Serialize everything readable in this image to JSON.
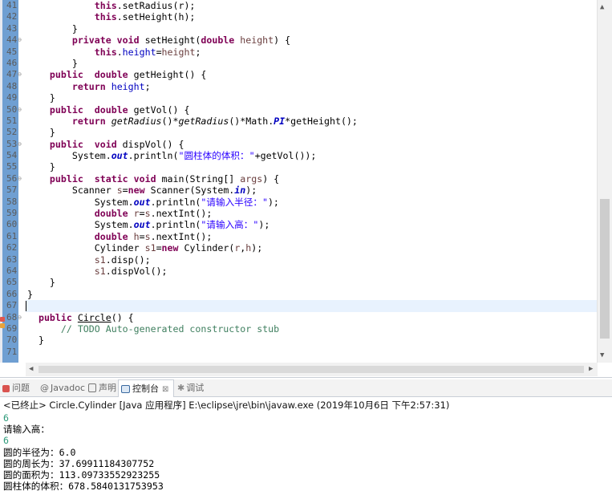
{
  "editor": {
    "lines": [
      {
        "n": "41",
        "fold": "",
        "html": "            <span class=\"kw\">this</span>.setRadius(r);"
      },
      {
        "n": "42",
        "fold": "",
        "html": "            <span class=\"kw\">this</span>.setHeight(h);"
      },
      {
        "n": "43",
        "fold": "",
        "html": "        }"
      },
      {
        "n": "44",
        "fold": "⊖",
        "html": "        <span class=\"kw\">private void</span> setHeight(<span class=\"kw\">double</span> <span class=\"loc\">height</span>) {"
      },
      {
        "n": "45",
        "fold": "",
        "html": "            <span class=\"kw\">this</span>.<span class=\"fld\">height</span>=<span class=\"loc\">height</span>;"
      },
      {
        "n": "46",
        "fold": "",
        "html": "        }"
      },
      {
        "n": "47",
        "fold": "⊖",
        "html": "    <span class=\"kw\">public</span>  <span class=\"kw\">double</span> getHeight() {"
      },
      {
        "n": "48",
        "fold": "",
        "html": "        <span class=\"kw\">return</span> <span class=\"fld\">height</span>;"
      },
      {
        "n": "49",
        "fold": "",
        "html": "    }"
      },
      {
        "n": "50",
        "fold": "⊖",
        "html": "    <span class=\"kw\">public</span>  <span class=\"kw\">double</span> getVol() {"
      },
      {
        "n": "51",
        "fold": "",
        "html": "        <span class=\"kw\">return</span> <span class=\"it\">getRadius</span>()*<span class=\"it\">getRadius</span>()*Math.<span class=\"sf\">PI</span>*getHeight();"
      },
      {
        "n": "52",
        "fold": "",
        "html": "    }"
      },
      {
        "n": "53",
        "fold": "⊖",
        "html": "    <span class=\"kw\">public</span>  <span class=\"kw\">void</span> dispVol() {"
      },
      {
        "n": "54",
        "fold": "",
        "html": "        System.<span class=\"sf\">out</span>.println(<span class=\"str\">\"圆柱体的体积：\"</span>+getVol());"
      },
      {
        "n": "55",
        "fold": "",
        "html": "    }"
      },
      {
        "n": "56",
        "fold": "⊖",
        "html": "    <span class=\"kw\">public</span>  <span class=\"kw\">static void</span> main(String[] <span class=\"loc\">args</span>) {"
      },
      {
        "n": "57",
        "fold": "",
        "html": "        Scanner <span class=\"loc\">s</span>=<span class=\"kw\">new</span> Scanner(System.<span class=\"sf\">in</span>);"
      },
      {
        "n": "58",
        "fold": "",
        "html": "            System.<span class=\"sf\">out</span>.println(<span class=\"str\">\"请输入半径：\"</span>);"
      },
      {
        "n": "59",
        "fold": "",
        "html": "            <span class=\"kw\">double</span> <span class=\"loc\">r</span>=<span class=\"loc\">s</span>.nextInt();"
      },
      {
        "n": "60",
        "fold": "",
        "html": "            System.<span class=\"sf\">out</span>.println(<span class=\"str\">\"请输入高：\"</span>);"
      },
      {
        "n": "61",
        "fold": "",
        "html": "            <span class=\"kw\">double</span> <span class=\"loc\">h</span>=<span class=\"loc\">s</span>.nextInt();"
      },
      {
        "n": "62",
        "fold": "",
        "html": "            Cylinder <span class=\"loc\">s1</span>=<span class=\"kw\">new</span> Cylinder(<span class=\"loc\">r</span>,<span class=\"loc\">h</span>);"
      },
      {
        "n": "63",
        "fold": "",
        "html": "            <span class=\"loc\">s1</span>.disp();"
      },
      {
        "n": "64",
        "fold": "",
        "html": "            <span class=\"loc\">s1</span>.dispVol();"
      },
      {
        "n": "65",
        "fold": "",
        "html": "    }"
      },
      {
        "n": "66",
        "fold": "",
        "html": "}"
      },
      {
        "n": "67",
        "fold": "",
        "html": "<span class=\"caret\"></span>",
        "current": true
      },
      {
        "n": "68",
        "fold": "⊖",
        "html": "  <span class=\"kw\">public</span> <span class=\"ul\">Circle</span>() {"
      },
      {
        "n": "69",
        "fold": "",
        "html": "      <span class=\"cmt\">// TODO Auto-generated constructor stub</span>"
      },
      {
        "n": "70",
        "fold": "",
        "html": "  }"
      },
      {
        "n": "71",
        "fold": "",
        "html": ""
      }
    ],
    "colors": {
      "gutter": "#6f9fd2",
      "keyword": "#7f0055",
      "string": "#2a00ff",
      "comment": "#3f7f5f",
      "field": "#0000c0"
    }
  },
  "tabs": [
    {
      "label": "问题",
      "icon": "problems-icon"
    },
    {
      "label": "Javadoc",
      "icon": "javadoc-icon"
    },
    {
      "label": "声明",
      "icon": "declaration-icon"
    },
    {
      "label": "控制台",
      "icon": "console-icon",
      "close": "⊠"
    },
    {
      "label": "调试",
      "icon": "debug-icon"
    }
  ],
  "console": {
    "status": "<已终止> Circle.Cylinder [Java 应用程序] E:\\eclipse\\jre\\bin\\javaw.exe  (2019年10月6日 下午2:57:31)",
    "lines": [
      {
        "text": "6",
        "input": true
      },
      {
        "text": "请输入高：",
        "input": false
      },
      {
        "text": "6",
        "input": true
      },
      {
        "text": "圆的半径为：6.0",
        "input": false
      },
      {
        "text": "圆的周长为：37.69911184307752",
        "input": false
      },
      {
        "text": "圆的面积为：113.09733552923255",
        "input": false
      },
      {
        "text": "圆柱体的体积：678.5840131753953",
        "input": false
      }
    ]
  }
}
